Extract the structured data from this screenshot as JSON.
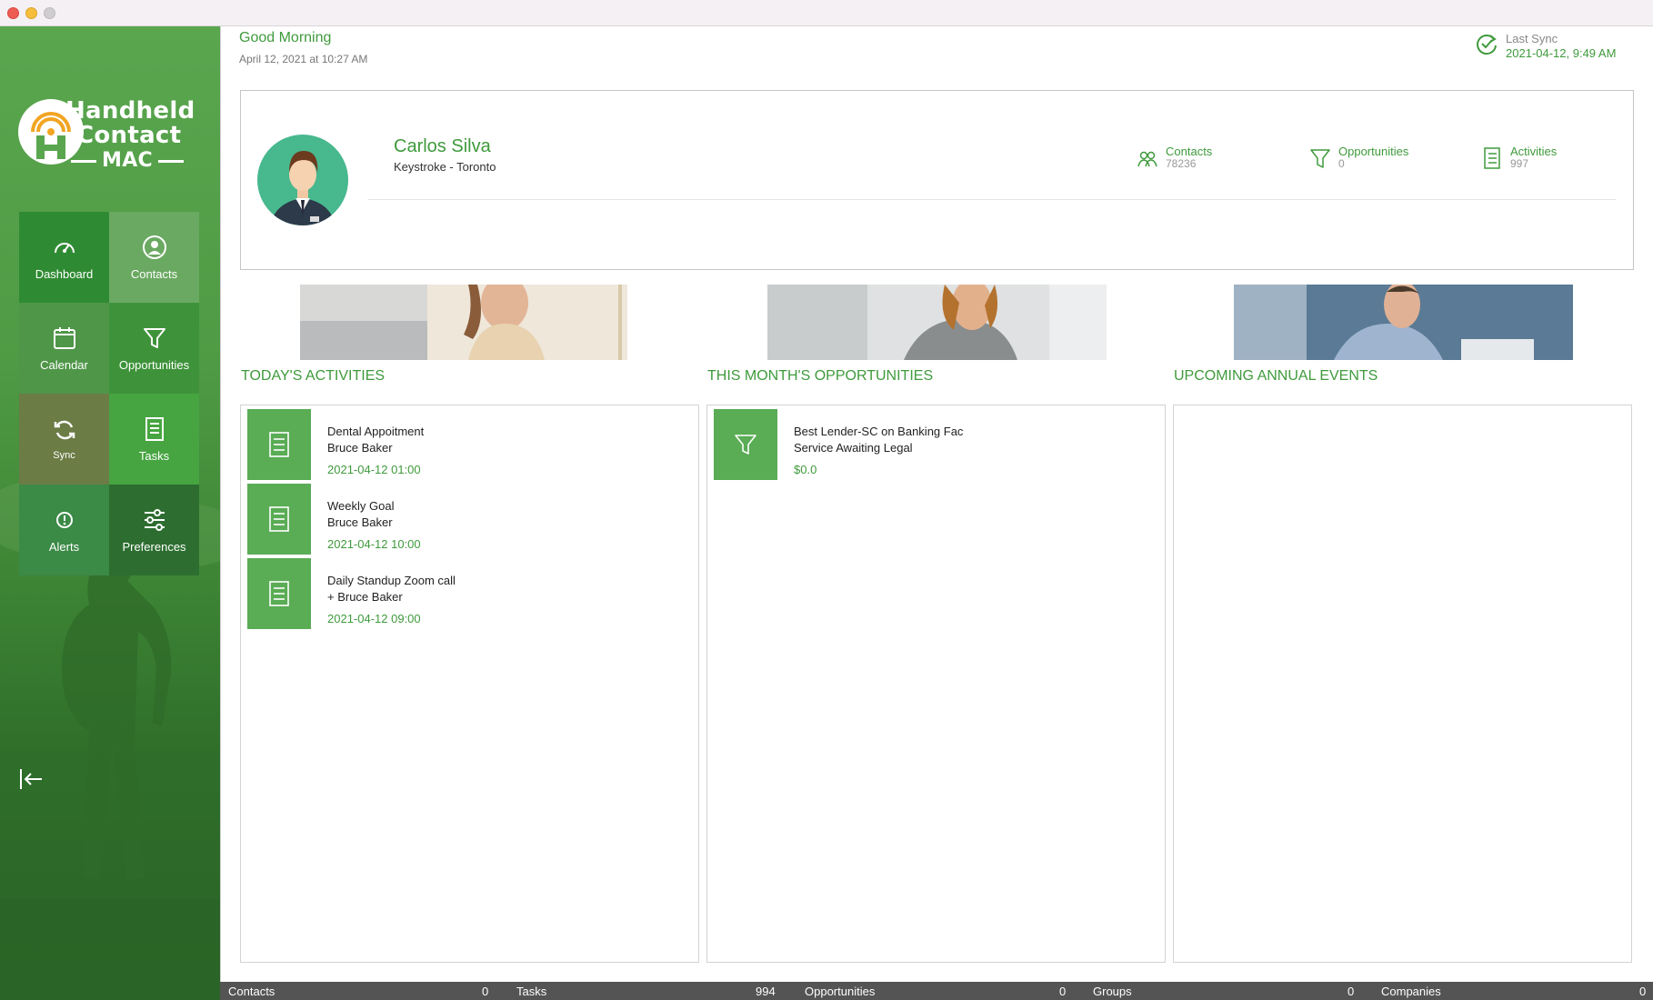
{
  "window": {
    "title": ""
  },
  "sidebar": {
    "logo": {
      "line1": "Handheld",
      "line2": "Contact",
      "line3": "MAC"
    },
    "tiles": [
      {
        "label": "Dashboard"
      },
      {
        "label": "Contacts"
      },
      {
        "label": "Calendar"
      },
      {
        "label": "Opportunities"
      },
      {
        "label": "Sync"
      },
      {
        "label": "Tasks"
      },
      {
        "label": "Alerts"
      },
      {
        "label": "Preferences"
      }
    ]
  },
  "header": {
    "greeting": "Good Morning",
    "date": "April 12, 2021 at 10:27 AM",
    "last_sync_label": "Last Sync",
    "last_sync_value": "2021-04-12, 9:49 AM"
  },
  "profile": {
    "name": "Carlos Silva",
    "org": "Keystroke - Toronto",
    "stats": [
      {
        "label": "Contacts",
        "value": "78236",
        "icon": "contacts-icon"
      },
      {
        "label": "Opportunities",
        "value": "0",
        "icon": "funnel-icon"
      },
      {
        "label": "Activities",
        "value": "997",
        "icon": "checklist-icon"
      }
    ]
  },
  "sections": {
    "activities": {
      "title": "TODAY'S ACTIVITIES",
      "items": [
        {
          "line1": "Dental Appoitment",
          "line2": "Bruce Baker",
          "line3": "2021-04-12 01:00"
        },
        {
          "line1": "Weekly Goal",
          "line2": "Bruce Baker",
          "line3": "2021-04-12 10:00"
        },
        {
          "line1": "Daily Standup Zoom call",
          "line2": "+ Bruce Baker",
          "line3": "2021-04-12 09:00"
        }
      ]
    },
    "opportunities": {
      "title": "THIS MONTH'S OPPORTUNITIES",
      "items": [
        {
          "line1": "Best Lender-SC on Banking Fac",
          "line2": "Service Awaiting Legal",
          "line3": "$0.0"
        }
      ]
    },
    "events": {
      "title": "UPCOMING ANNUAL EVENTS",
      "items": []
    }
  },
  "statusbar": [
    {
      "label": "Contacts",
      "value": "0"
    },
    {
      "label": "Tasks",
      "value": "994"
    },
    {
      "label": "Opportunities",
      "value": "0"
    },
    {
      "label": "Groups",
      "value": "0"
    },
    {
      "label": "Companies",
      "value": "0"
    }
  ],
  "colors": {
    "accent": "#3f9a3c",
    "tile_green": "#5aac55",
    "statusbar": "#545454"
  }
}
